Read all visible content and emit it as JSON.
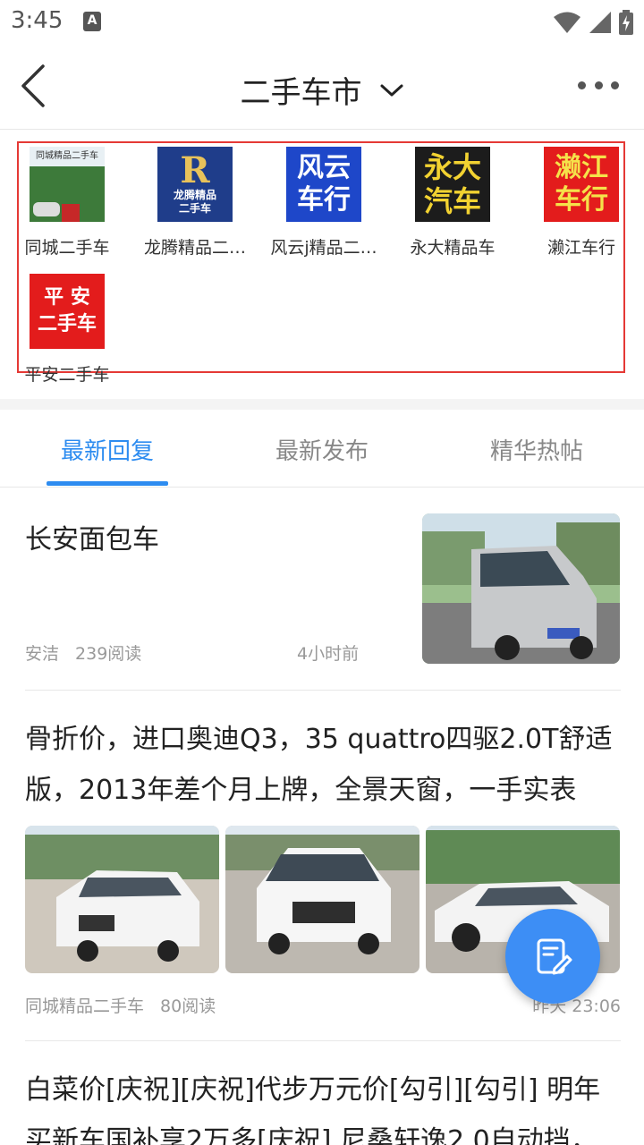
{
  "status_bar": {
    "time": "3:45",
    "a_icon": "A",
    "icons": [
      "a-icon",
      "wifi-icon",
      "signal-icon",
      "battery-charging-icon"
    ]
  },
  "header": {
    "title": "二手车市",
    "icons": [
      "back-arrow-icon",
      "chevron-down-icon",
      "more-dots-icon"
    ]
  },
  "merchants": [
    {
      "name": "同城二手车",
      "logo_text": "同城精品二手车"
    },
    {
      "name": "龙腾精品二…",
      "logo_mark": "R",
      "logo_line1": "龙腾精品",
      "logo_line2": "二手车"
    },
    {
      "name": "风云j精品二…",
      "logo_line1": "风云",
      "logo_line2": "车行"
    },
    {
      "name": "永大精品车",
      "logo_line1": "永大",
      "logo_line2": "汽车"
    },
    {
      "name": "濑江车行",
      "logo_line1": "濑江",
      "logo_line2": "车行"
    },
    {
      "name": "平安二手车",
      "logo_line1": "平 安",
      "logo_line2": "二手车"
    }
  ],
  "tabs": [
    {
      "label": "最新回复",
      "active": true
    },
    {
      "label": "最新发布",
      "active": false
    },
    {
      "label": "精华热帖",
      "active": false
    }
  ],
  "posts": [
    {
      "title": "长安面包车",
      "author": "安洁",
      "reads": "239阅读",
      "time": "4小时前"
    },
    {
      "title": "骨折价，进口奥迪Q3，35 quattro四驱2.0T舒适版，2013年差个月上牌，全景天窗，一手实表",
      "author": "同城精品二手车",
      "reads": "80阅读",
      "time": "昨天 23:06"
    },
    {
      "title": "白菜价[庆祝][庆祝]代步万元价[勾引][勾引] 明年买新车国补享2万多[庆祝] 尼桑轩逸2.0自动挡，"
    }
  ],
  "fab": {
    "icon": "edit-post-icon"
  },
  "colors": {
    "accent": "#2d8cf0",
    "fab": "#3d8ef5",
    "highlight_border": "#e53935"
  }
}
